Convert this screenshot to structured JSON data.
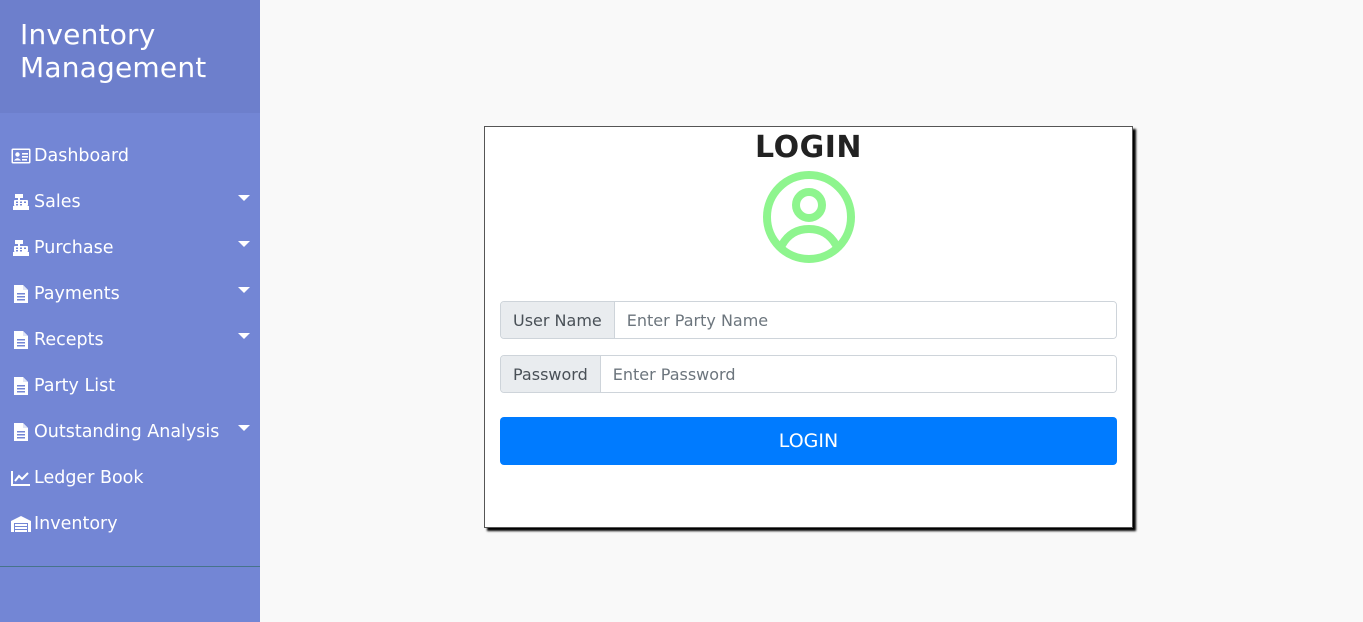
{
  "sidebar": {
    "title": "Inventory Management",
    "items": [
      {
        "label": "Dashboard",
        "icon": "id-card-icon",
        "has_dropdown": false
      },
      {
        "label": "Sales",
        "icon": "cash-register-icon",
        "has_dropdown": true
      },
      {
        "label": "Purchase",
        "icon": "cash-register-icon",
        "has_dropdown": true
      },
      {
        "label": "Payments",
        "icon": "file-icon",
        "has_dropdown": true
      },
      {
        "label": "Recepts",
        "icon": "file-icon",
        "has_dropdown": true
      },
      {
        "label": "Party List",
        "icon": "file-icon",
        "has_dropdown": false
      },
      {
        "label": "Outstanding Analysis",
        "icon": "file-icon",
        "has_dropdown": true
      },
      {
        "label": "Ledger Book",
        "icon": "chart-line-icon",
        "has_dropdown": false
      },
      {
        "label": "Inventory",
        "icon": "warehouse-icon",
        "has_dropdown": false
      }
    ]
  },
  "login": {
    "heading": "LOGIN",
    "avatar_icon": "user-circle-icon",
    "username_label": "User Name",
    "username_placeholder": "Enter Party Name",
    "username_value": "",
    "password_label": "Password",
    "password_placeholder": "Enter Password",
    "password_value": "",
    "button_label": "LOGIN"
  },
  "colors": {
    "sidebar_bg": "#7386d5",
    "sidebar_header_bg": "#6d7fcc",
    "button_primary": "#007bff",
    "avatar_green": "#8ef58e"
  }
}
